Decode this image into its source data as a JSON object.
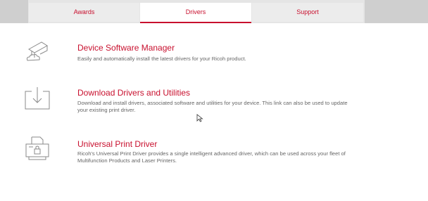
{
  "tabs": [
    {
      "label": "Awards"
    },
    {
      "label": "Drivers"
    },
    {
      "label": "Support"
    }
  ],
  "selected_tab": "Drivers",
  "accent_color": "#c8102e",
  "items": [
    {
      "icon": "device-software-manager-icon",
      "title": "Device Software Manager",
      "description": "Easily and automatically install the latest drivers for your Ricoh product."
    },
    {
      "icon": "download-icon",
      "title": "Download Drivers and Utilities",
      "description": "Download and install drivers, associated software and utilities for your device. This link can also be used to update your existing print driver."
    },
    {
      "icon": "printer-icon",
      "title": "Universal Print Driver",
      "description": "Ricoh's Universal Print Driver provides a single intelligent advanced driver, which can be used across your fleet of Multifunction Products and Laser Printers."
    }
  ]
}
